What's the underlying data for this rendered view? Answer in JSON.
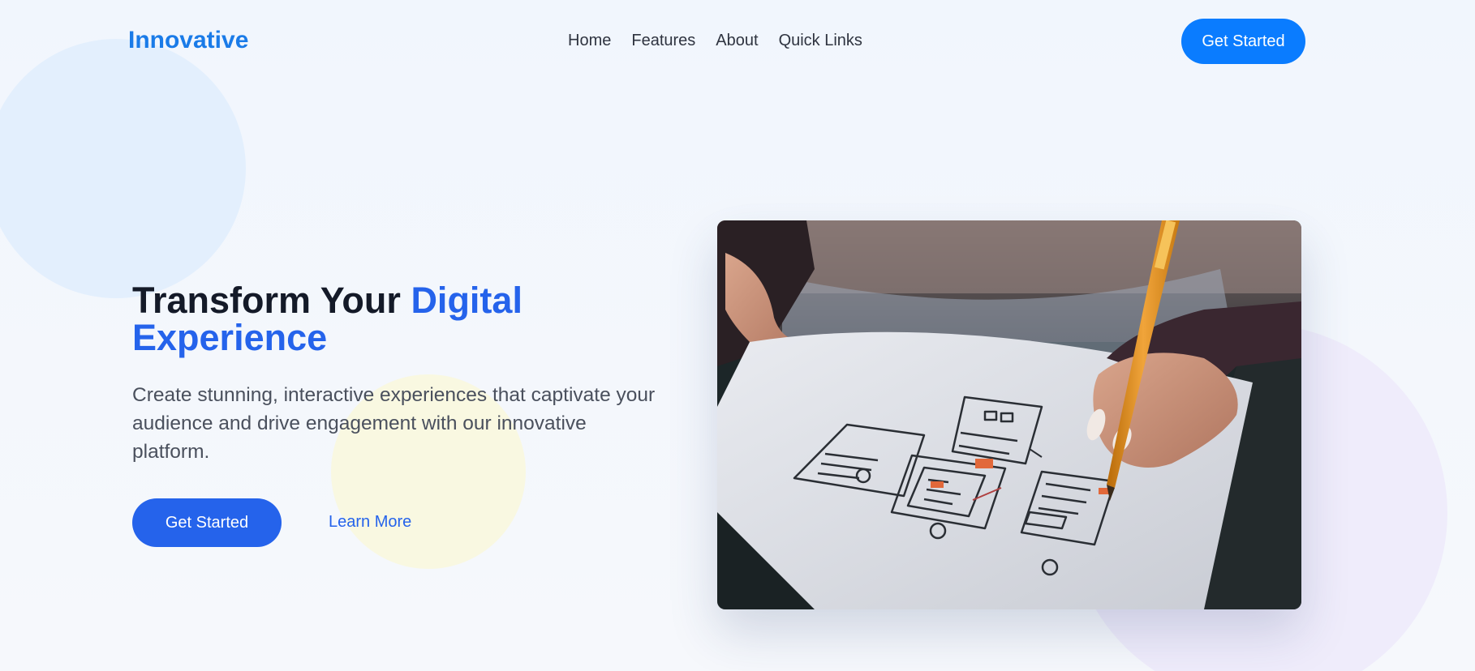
{
  "nav": {
    "logo": "Innovative",
    "links": [
      "Home",
      "Features",
      "About",
      "Quick Links"
    ],
    "cta": "Get Started"
  },
  "hero": {
    "title_plain": "Transform Your",
    "title_accent": "Digital Experience",
    "description": "Create stunning, interactive experiences that captivate your audience and drive engagement with our innovative platform.",
    "primary_cta": "Get Started",
    "secondary_cta": "Learn More"
  },
  "colors": {
    "brand_blue": "#0a7cff",
    "accent_blue": "#2563eb",
    "heading": "#141a28",
    "body_text": "#4a505d"
  }
}
